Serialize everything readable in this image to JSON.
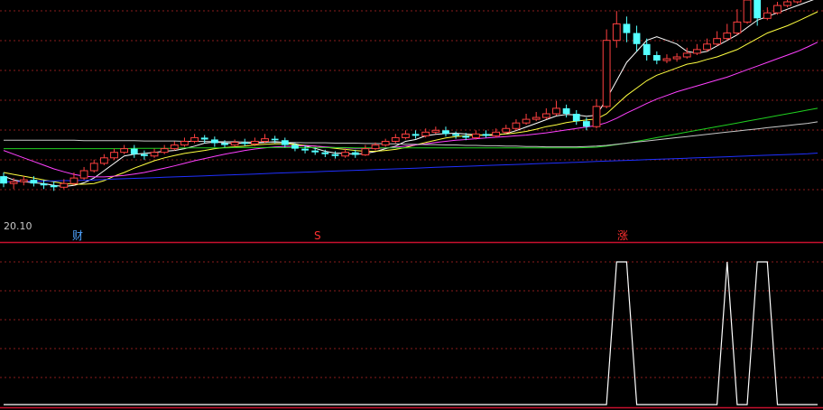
{
  "colors": {
    "background": "#000000",
    "grid": "#8a1c1c",
    "separator": "#c8102e",
    "up_candle": "#ff4040",
    "down_candle": "#54ffff",
    "ma5": "#ffffff",
    "ma10": "#ffff40",
    "ma20": "#ff40ff",
    "ma60": "#20d020",
    "ma120": "#c8c8c8",
    "ma250": "#2030ff",
    "indicator": "#ffffff"
  },
  "panels": {
    "price_label": "20.10",
    "markers": [
      "财",
      "S",
      "涨"
    ]
  },
  "chart_data": [
    {
      "type": "candlestick",
      "title": "",
      "ylim": [
        19.8,
        26.0
      ],
      "grid": true,
      "candles": [
        [
          21.2,
          21.0,
          21.3,
          20.9
        ],
        [
          21.0,
          21.05,
          21.15,
          20.85
        ],
        [
          21.05,
          21.1,
          21.2,
          20.95
        ],
        [
          21.1,
          21.0,
          21.2,
          20.92
        ],
        [
          21.0,
          20.95,
          21.1,
          20.85
        ],
        [
          20.95,
          20.9,
          21.05,
          20.8
        ],
        [
          20.9,
          21.0,
          21.12,
          20.85
        ],
        [
          21.0,
          21.15,
          21.3,
          20.95
        ],
        [
          21.15,
          21.35,
          21.45,
          21.1
        ],
        [
          21.35,
          21.55,
          21.65,
          21.3
        ],
        [
          21.55,
          21.7,
          21.8,
          21.5
        ],
        [
          21.7,
          21.85,
          21.95,
          21.65
        ],
        [
          21.85,
          21.95,
          22.05,
          21.8
        ],
        [
          21.95,
          21.8,
          22.05,
          21.7
        ],
        [
          21.8,
          21.75,
          21.9,
          21.65
        ],
        [
          21.75,
          21.85,
          21.95,
          21.7
        ],
        [
          21.85,
          21.95,
          22.05,
          21.8
        ],
        [
          21.95,
          22.05,
          22.15,
          21.9
        ],
        [
          22.05,
          22.15,
          22.25,
          22.0
        ],
        [
          22.15,
          22.25,
          22.35,
          22.1
        ],
        [
          22.25,
          22.2,
          22.32,
          22.1
        ],
        [
          22.2,
          22.1,
          22.28,
          22.0
        ],
        [
          22.1,
          22.05,
          22.18,
          21.98
        ],
        [
          22.05,
          22.12,
          22.2,
          22.0
        ],
        [
          22.12,
          22.08,
          22.22,
          22.02
        ],
        [
          22.08,
          22.15,
          22.25,
          22.02
        ],
        [
          22.15,
          22.22,
          22.35,
          22.1
        ],
        [
          22.22,
          22.18,
          22.3,
          22.1
        ],
        [
          22.18,
          22.05,
          22.25,
          21.98
        ],
        [
          22.05,
          21.95,
          22.1,
          21.88
        ],
        [
          21.95,
          21.9,
          22.05,
          21.82
        ],
        [
          21.9,
          21.85,
          21.98,
          21.78
        ],
        [
          21.85,
          21.8,
          21.92,
          21.72
        ],
        [
          21.8,
          21.75,
          21.88,
          21.68
        ],
        [
          21.75,
          21.85,
          21.95,
          21.7
        ],
        [
          21.85,
          21.78,
          21.92,
          21.7
        ],
        [
          21.78,
          21.95,
          22.05,
          21.75
        ],
        [
          21.95,
          22.05,
          22.12,
          21.9
        ],
        [
          22.05,
          22.15,
          22.22,
          22.0
        ],
        [
          22.15,
          22.25,
          22.35,
          22.1
        ],
        [
          22.25,
          22.35,
          22.45,
          22.2
        ],
        [
          22.35,
          22.3,
          22.45,
          22.22
        ],
        [
          22.3,
          22.4,
          22.5,
          22.25
        ],
        [
          22.4,
          22.45,
          22.55,
          22.35
        ],
        [
          22.45,
          22.35,
          22.55,
          22.28
        ],
        [
          22.35,
          22.3,
          22.42,
          22.22
        ],
        [
          22.3,
          22.25,
          22.38,
          22.18
        ],
        [
          22.25,
          22.35,
          22.45,
          22.2
        ],
        [
          22.35,
          22.3,
          22.45,
          22.25
        ],
        [
          22.3,
          22.4,
          22.5,
          22.25
        ],
        [
          22.4,
          22.5,
          22.6,
          22.35
        ],
        [
          22.5,
          22.65,
          22.75,
          22.45
        ],
        [
          22.65,
          22.75,
          22.9,
          22.6
        ],
        [
          22.75,
          22.8,
          22.95,
          22.7
        ],
        [
          22.8,
          22.9,
          23.05,
          22.75
        ],
        [
          22.9,
          23.05,
          23.25,
          22.85
        ],
        [
          23.05,
          22.9,
          23.15,
          22.8
        ],
        [
          22.9,
          22.7,
          23.0,
          22.6
        ],
        [
          22.7,
          22.55,
          22.8,
          22.45
        ],
        [
          22.55,
          23.1,
          23.3,
          22.5
        ],
        [
          23.1,
          24.9,
          25.2,
          23.05
        ],
        [
          24.9,
          25.35,
          25.7,
          24.7
        ],
        [
          25.35,
          25.1,
          25.55,
          24.85
        ],
        [
          25.1,
          24.8,
          25.3,
          24.6
        ],
        [
          24.8,
          24.5,
          24.95,
          24.35
        ],
        [
          24.5,
          24.35,
          24.6,
          24.25
        ],
        [
          24.35,
          24.4,
          24.52,
          24.28
        ],
        [
          24.4,
          24.45,
          24.55,
          24.32
        ],
        [
          24.45,
          24.55,
          24.7,
          24.4
        ],
        [
          24.55,
          24.65,
          24.8,
          24.5
        ],
        [
          24.65,
          24.8,
          24.95,
          24.6
        ],
        [
          24.8,
          24.95,
          25.15,
          24.75
        ],
        [
          24.95,
          25.1,
          25.35,
          24.9
        ],
        [
          25.1,
          25.4,
          25.75,
          25.05
        ],
        [
          25.4,
          26.0,
          26.1,
          25.35
        ],
        [
          26.0,
          25.5,
          26.05,
          25.3
        ],
        [
          25.5,
          25.65,
          25.8,
          25.45
        ],
        [
          25.65,
          25.85,
          25.95,
          25.6
        ],
        [
          25.85,
          25.95,
          26.0,
          25.8
        ],
        [
          25.95,
          26.05,
          26.1,
          25.9
        ],
        [
          26.05,
          26.2,
          26.3,
          26.0
        ],
        [
          26.2,
          26.25,
          26.35,
          26.15
        ]
      ],
      "series": [
        {
          "values": [
            21.2,
            21.1,
            21.05,
            21.02,
            21.0,
            20.95,
            20.92,
            20.95,
            21.02,
            21.15,
            21.35,
            21.55,
            21.75,
            21.8,
            21.82,
            21.85,
            21.88,
            21.9,
            21.95,
            22.02,
            22.1,
            22.13,
            22.11,
            22.1,
            22.1,
            22.1,
            22.12,
            22.14,
            22.12,
            22.08,
            22.02,
            21.96,
            21.88,
            21.83,
            21.82,
            21.8,
            21.82,
            21.87,
            21.95,
            22.02,
            22.15,
            22.2,
            22.3,
            22.34,
            22.36,
            22.37,
            22.35,
            22.33,
            22.31,
            22.32,
            22.36,
            22.44,
            22.54,
            22.64,
            22.74,
            22.84,
            22.88,
            22.87,
            22.83,
            22.86,
            23.3,
            23.8,
            24.3,
            24.6,
            24.9,
            25.0,
            24.9,
            24.8,
            24.6,
            24.55,
            24.6,
            24.75,
            24.9,
            25.05,
            25.25,
            25.45,
            25.55,
            25.65,
            25.75,
            25.85,
            25.95,
            26.05
          ]
        },
        {
          "values": [
            21.3,
            21.25,
            21.2,
            21.15,
            21.1,
            21.05,
            21.0,
            20.98,
            20.98,
            21.0,
            21.08,
            21.2,
            21.3,
            21.42,
            21.52,
            21.62,
            21.7,
            21.76,
            21.82,
            21.86,
            21.9,
            21.95,
            21.98,
            22.0,
            22.02,
            22.05,
            22.07,
            22.08,
            22.08,
            22.06,
            22.04,
            22.02,
            21.99,
            21.96,
            21.93,
            21.9,
            21.88,
            21.88,
            21.9,
            21.93,
            21.98,
            22.05,
            22.12,
            22.18,
            22.24,
            22.28,
            22.3,
            22.32,
            22.33,
            22.34,
            22.35,
            22.38,
            22.42,
            22.48,
            22.55,
            22.6,
            22.66,
            22.7,
            22.73,
            22.76,
            22.9,
            23.15,
            23.4,
            23.6,
            23.8,
            23.95,
            24.05,
            24.15,
            24.25,
            24.3,
            24.38,
            24.45,
            24.55,
            24.65,
            24.8,
            24.95,
            25.1,
            25.2,
            25.3,
            25.42,
            25.55,
            25.68
          ]
        },
        {
          "values": [
            21.9,
            21.8,
            21.7,
            21.6,
            21.5,
            21.4,
            21.32,
            21.25,
            21.2,
            21.18,
            21.18,
            21.2,
            21.22,
            21.26,
            21.3,
            21.36,
            21.42,
            21.48,
            21.55,
            21.62,
            21.68,
            21.74,
            21.8,
            21.85,
            21.9,
            21.94,
            21.97,
            22.0,
            22.01,
            22.02,
            22.03,
            22.02,
            22.0,
            21.98,
            21.97,
            21.96,
            21.96,
            21.96,
            21.97,
            21.99,
            22.02,
            22.05,
            22.08,
            22.12,
            22.15,
            22.18,
            22.2,
            22.22,
            22.24,
            22.26,
            22.28,
            22.3,
            22.32,
            22.35,
            22.38,
            22.42,
            22.46,
            22.5,
            22.54,
            22.58,
            22.66,
            22.78,
            22.92,
            23.05,
            23.18,
            23.3,
            23.4,
            23.5,
            23.58,
            23.66,
            23.74,
            23.82,
            23.9,
            24.0,
            24.1,
            24.2,
            24.3,
            24.4,
            24.5,
            24.6,
            24.72,
            24.85
          ]
        },
        {
          "values": [
            21.95,
            21.95,
            21.95,
            21.95,
            21.95,
            21.95,
            21.95,
            21.95,
            21.95,
            21.95,
            21.95,
            21.95,
            21.95,
            21.96,
            21.96,
            21.96,
            21.96,
            21.96,
            21.97,
            21.97,
            21.97,
            21.97,
            21.97,
            21.98,
            21.98,
            21.98,
            21.98,
            21.98,
            21.98,
            21.98,
            21.98,
            21.98,
            21.98,
            21.98,
            21.98,
            21.97,
            21.97,
            21.97,
            21.97,
            21.97,
            21.97,
            21.97,
            21.97,
            21.97,
            21.97,
            21.97,
            21.97,
            21.97,
            21.97,
            21.97,
            21.97,
            21.97,
            21.97,
            21.97,
            21.97,
            21.97,
            21.97,
            21.97,
            21.98,
            21.99,
            22.02,
            22.06,
            22.1,
            22.15,
            22.2,
            22.25,
            22.3,
            22.35,
            22.4,
            22.45,
            22.5,
            22.55,
            22.6,
            22.65,
            22.7,
            22.75,
            22.8,
            22.85,
            22.9,
            22.95,
            23.0,
            23.05
          ]
        },
        {
          "values": [
            22.18,
            22.18,
            22.18,
            22.18,
            22.18,
            22.18,
            22.18,
            22.18,
            22.17,
            22.17,
            22.17,
            22.17,
            22.17,
            22.17,
            22.16,
            22.16,
            22.16,
            22.16,
            22.15,
            22.15,
            22.15,
            22.14,
            22.14,
            22.14,
            22.13,
            22.13,
            22.13,
            22.12,
            22.12,
            22.12,
            22.11,
            22.11,
            22.11,
            22.1,
            22.1,
            22.1,
            22.09,
            22.09,
            22.08,
            22.08,
            22.07,
            22.07,
            22.06,
            22.06,
            22.05,
            22.05,
            22.04,
            22.04,
            22.03,
            22.03,
            22.02,
            22.02,
            22.01,
            22.01,
            22.0,
            22.0,
            22.0,
            22.0,
            22.01,
            22.02,
            22.04,
            22.07,
            22.1,
            22.13,
            22.16,
            22.19,
            22.22,
            22.25,
            22.28,
            22.31,
            22.34,
            22.37,
            22.4,
            22.43,
            22.46,
            22.49,
            22.52,
            22.55,
            22.58,
            22.61,
            22.64,
            22.68
          ]
        },
        {
          "values": [
            21.05,
            21.05,
            21.06,
            21.06,
            21.07,
            21.07,
            21.08,
            21.08,
            21.09,
            21.1,
            21.11,
            21.12,
            21.13,
            21.14,
            21.15,
            21.16,
            21.17,
            21.18,
            21.19,
            21.2,
            21.21,
            21.22,
            21.23,
            21.24,
            21.25,
            21.26,
            21.27,
            21.28,
            21.29,
            21.3,
            21.31,
            21.32,
            21.33,
            21.34,
            21.35,
            21.36,
            21.37,
            21.38,
            21.39,
            21.4,
            21.41,
            21.42,
            21.43,
            21.44,
            21.45,
            21.46,
            21.47,
            21.48,
            21.49,
            21.5,
            21.51,
            21.52,
            21.53,
            21.54,
            21.55,
            21.56,
            21.57,
            21.58,
            21.59,
            21.6,
            21.61,
            21.62,
            21.63,
            21.64,
            21.65,
            21.66,
            21.67,
            21.68,
            21.69,
            21.7,
            21.71,
            21.72,
            21.73,
            21.74,
            21.75,
            21.76,
            21.77,
            21.78,
            21.79,
            21.8,
            21.81,
            21.83
          ]
        }
      ]
    },
    {
      "type": "line",
      "title": "",
      "ylim": [
        0,
        1
      ],
      "grid": true,
      "series": [
        {
          "values": [
            0,
            0,
            0,
            0,
            0,
            0,
            0,
            0,
            0,
            0,
            0,
            0,
            0,
            0,
            0,
            0,
            0,
            0,
            0,
            0,
            0,
            0,
            0,
            0,
            0,
            0,
            0,
            0,
            0,
            0,
            0,
            0,
            0,
            0,
            0,
            0,
            0,
            0,
            0,
            0,
            0,
            0,
            0,
            0,
            0,
            0,
            0,
            0,
            0,
            0,
            0,
            0,
            0,
            0,
            0,
            0,
            0,
            0,
            0,
            0,
            0,
            1,
            1,
            0,
            0,
            0,
            0,
            0,
            0,
            0,
            0,
            0,
            1,
            0,
            0,
            1,
            1,
            0,
            0,
            0,
            0,
            0
          ]
        }
      ]
    }
  ]
}
